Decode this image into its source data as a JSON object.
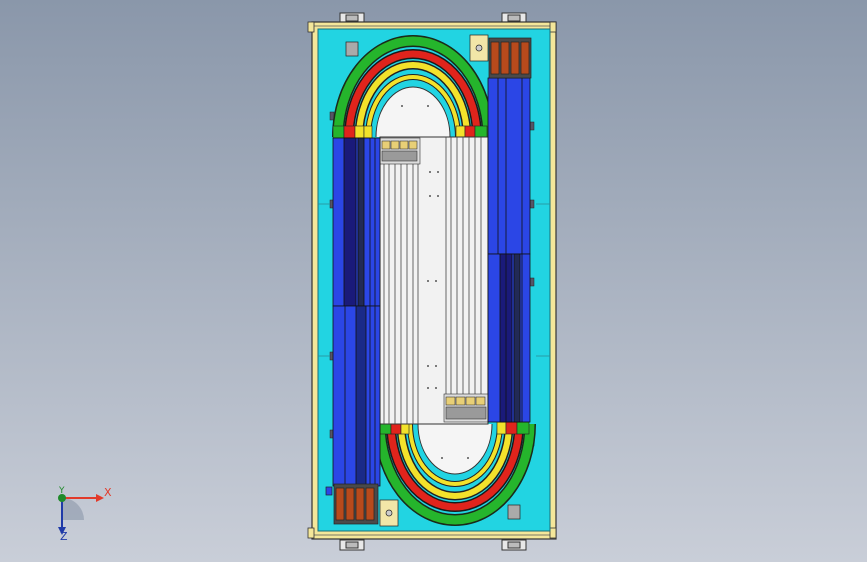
{
  "colors": {
    "background_top": "#8a97aa",
    "background_bottom": "#c9ced8",
    "frame": "#f4e79a",
    "plate": "#22d4e2",
    "track_green": "#25b52c",
    "track_red": "#e0241c",
    "track_yellow": "#f3e22b",
    "module_blue": "#2b46e6",
    "rail_white": "#f2f2f2",
    "axis_x": "#e23a2a",
    "axis_y": "#1f8a2a",
    "axis_z": "#1f3aa8"
  },
  "triad": {
    "x_label": "X",
    "y_label": "Y",
    "z_label": "Z"
  }
}
